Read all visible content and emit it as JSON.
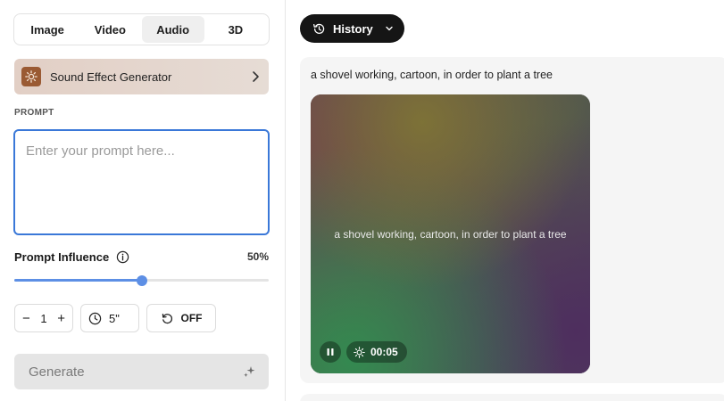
{
  "tabs": [
    {
      "label": "Image",
      "active": false
    },
    {
      "label": "Video",
      "active": false
    },
    {
      "label": "Audio",
      "active": true
    },
    {
      "label": "3D",
      "active": false
    }
  ],
  "generator": {
    "label": "Sound Effect Generator",
    "icon": "sound-effect-icon"
  },
  "prompt": {
    "section_label": "PROMPT",
    "placeholder": "Enter your prompt here...",
    "value": ""
  },
  "influence": {
    "label": "Prompt Influence",
    "value_text": "50%",
    "value": 0.5
  },
  "controls": {
    "count": "1",
    "minus": "−",
    "plus": "+",
    "duration": "5\"",
    "loop": "OFF"
  },
  "generate": {
    "label": "Generate"
  },
  "history": {
    "label": "History"
  },
  "result": {
    "title": "a shovel working, cartoon, in order to plant a tree",
    "caption": "a shovel working, cartoon, in order to plant a tree",
    "time": "00:05"
  },
  "colors": {
    "accent": "#3a78d8",
    "slider": "#5d8fe5",
    "history_bg": "#151515"
  }
}
